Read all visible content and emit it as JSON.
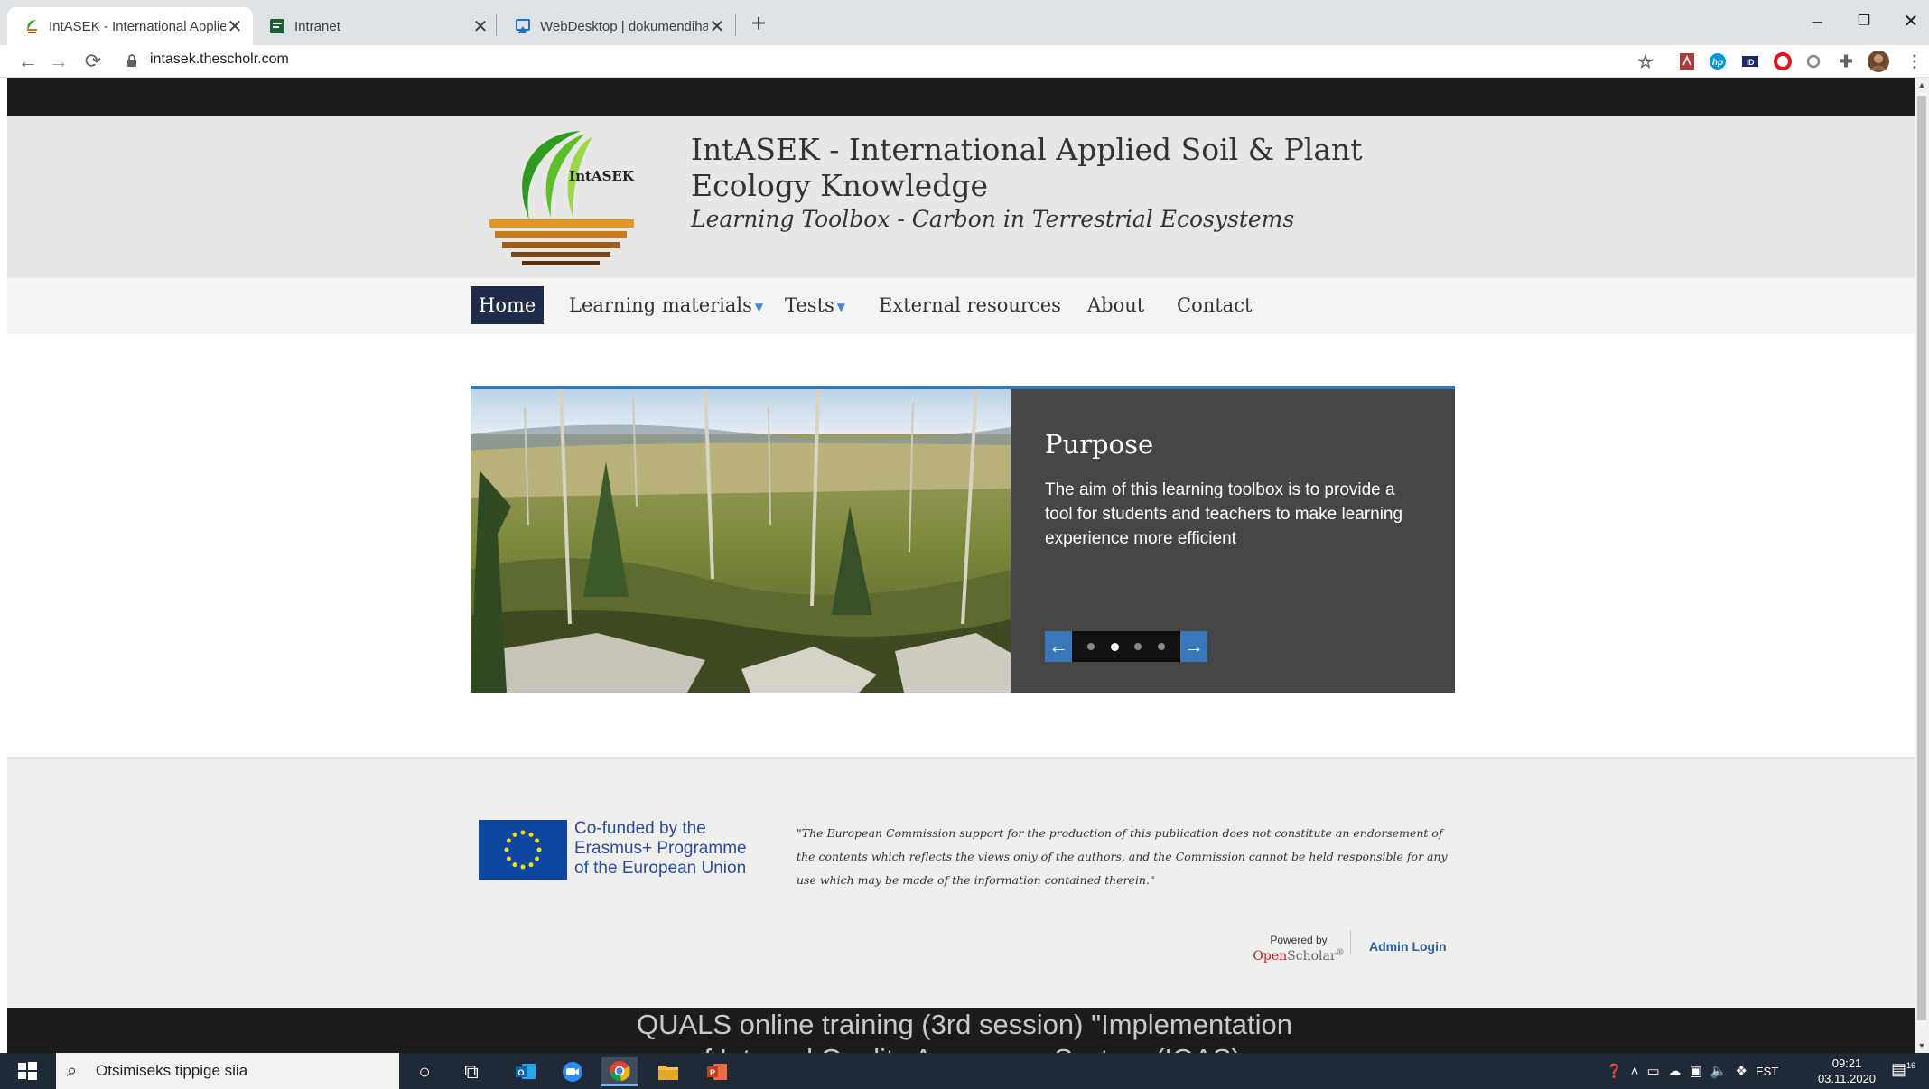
{
  "browser": {
    "tabs": [
      {
        "title": "IntASEK - International Applied S",
        "active": true
      },
      {
        "title": "Intranet",
        "active": false
      },
      {
        "title": "WebDesktop | dokumendihaldus",
        "active": false
      }
    ],
    "url": "intasek.thescholr.com",
    "new_tab_symbol": "+",
    "close_symbol": "✕",
    "window_controls": [
      "–",
      "❐",
      "✕"
    ]
  },
  "site": {
    "logo_text": "IntASEK",
    "title": "IntASEK - International Applied Soil & Plant Ecology Knowledge",
    "slogan": "Learning Toolbox - Carbon in Terrestrial Ecosystems"
  },
  "menu": [
    {
      "label": "Home",
      "active": true,
      "has_dropdown": false
    },
    {
      "label": "Learning materials",
      "active": false,
      "has_dropdown": true
    },
    {
      "label": "Tests",
      "active": false,
      "has_dropdown": true
    },
    {
      "label": "External resources",
      "active": false,
      "has_dropdown": false
    },
    {
      "label": "About",
      "active": false,
      "has_dropdown": false
    },
    {
      "label": "Contact",
      "active": false,
      "has_dropdown": false
    }
  ],
  "slideshow": {
    "title": "Purpose",
    "text": "The aim of this learning toolbox is to provide a tool for students and teachers to make learning experience more efficient",
    "dot_count": 4,
    "active_dot": 2,
    "accent_color": "#3b76b8"
  },
  "footer": {
    "eu_text": "Co-funded by the Erasmus+ Programme of the European Union",
    "disclaimer": "\"The European Commission support for the production of this publication does not constitute an endorsement of the contents which reflects the views only of the authors, and the Commission cannot be held responsible for any use which may be made of the information contained therein.\"",
    "powered_by_label": "Powered by",
    "powered_by_brand_1": "Open",
    "powered_by_brand_2": "Scholar",
    "powered_by_mark": "®",
    "admin_login": "Admin Login"
  },
  "overlay_caption": {
    "line1": "QUALS online training (3rd session) \"Implementation",
    "line2": "of Internal Quality Assurance System (IQAS)"
  },
  "taskbar": {
    "search_placeholder": "Otsimiseks tippige siia",
    "language": "EST",
    "time": "09:21",
    "date": "03.11.2020",
    "notification_count": "16"
  }
}
